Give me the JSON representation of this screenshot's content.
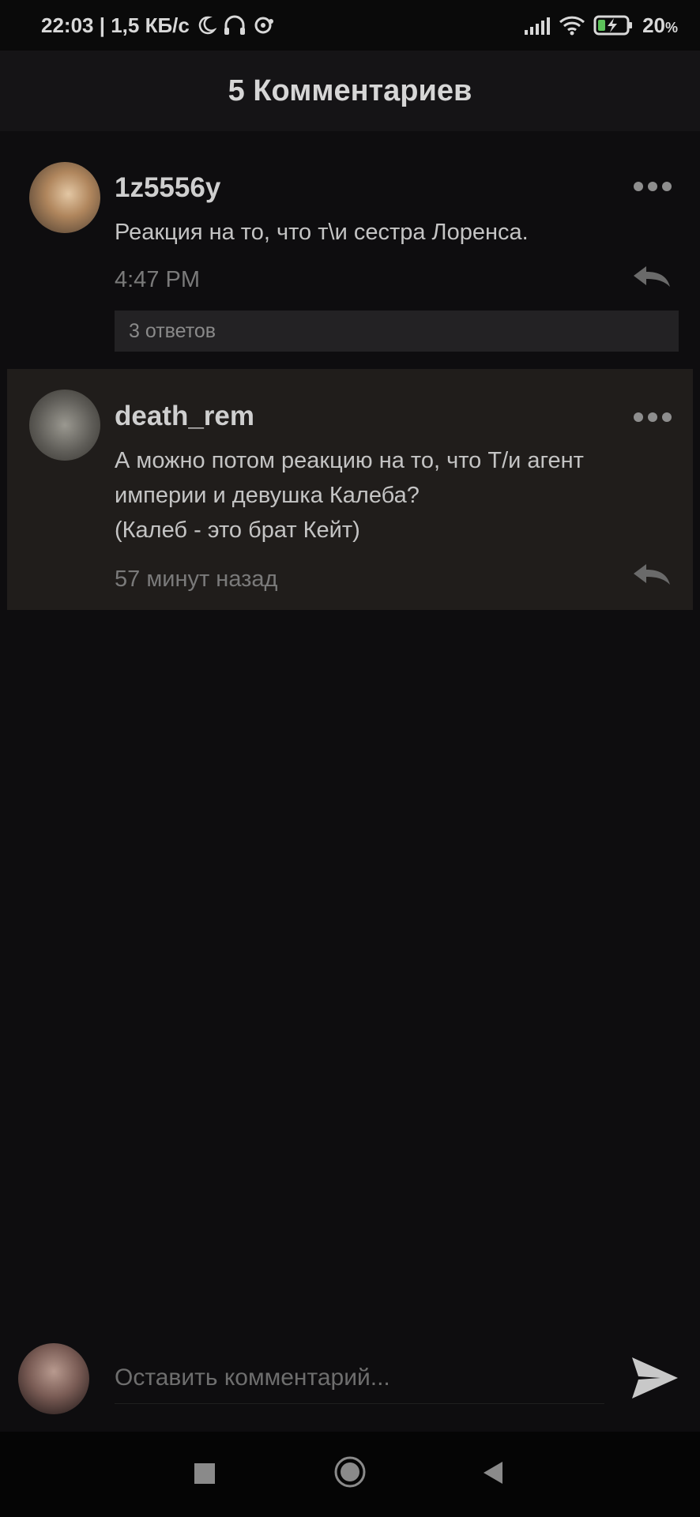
{
  "status_bar": {
    "time_speed": "22:03 | 1,5 КБ/с",
    "battery": "20",
    "battery_unit": "%"
  },
  "header": {
    "title": "5 Комментариев"
  },
  "comments": [
    {
      "username": "1z5556y",
      "text": "Реакция на то, что т\\и сестра Лоренса.",
      "time": "4:47 PM",
      "replies": "3 ответов"
    },
    {
      "username": "death_rem",
      "text": "А можно потом реакцию на то, что Т/и агент\nимперии и девушка Калеба?\n(Калеб - это брат Кейт)",
      "time": "57 минут назад"
    }
  ],
  "compose": {
    "placeholder": "Оставить комментарий..."
  },
  "icons": {
    "moon": "moon-icon",
    "headphones": "headphones-icon",
    "sync": "sync-icon",
    "signal": "signal-icon",
    "wifi": "wifi-icon",
    "battery": "battery-icon",
    "more": "more-icon",
    "reply": "reply-icon",
    "send": "send-icon"
  },
  "colors": {
    "background": "#0e0d0f",
    "header": "#151416",
    "highlight": "#201d1b",
    "replies_bar": "#232224"
  }
}
